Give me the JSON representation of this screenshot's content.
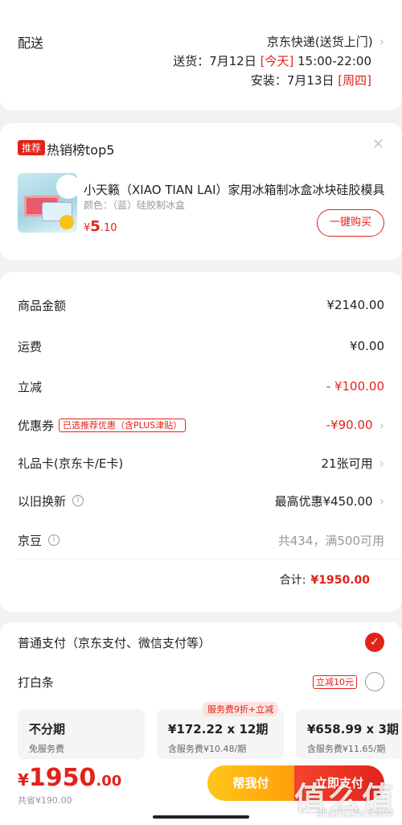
{
  "delivery": {
    "label": "配送",
    "method": "京东快递(送货上门)",
    "ship_label": "送货：7月12日",
    "ship_tag": "[今天]",
    "ship_time": "15:00-22:00",
    "install_label": "安装：7月13日",
    "install_tag": "[周四]"
  },
  "recommend": {
    "badge": "推荐",
    "title": "热销榜top5",
    "product_name": "小天籁（XIAO TIAN LAI）家用冰箱制冰盒冰块硅胶模具",
    "product_color": "颜色：（蓝）硅胶制冰盒",
    "price_symbol": "¥",
    "price_int": "5",
    "price_dec": ".10",
    "buy_label": "一键购买"
  },
  "summary": {
    "rows": [
      {
        "label": "商品金额",
        "value": "¥2140.00"
      },
      {
        "label": "运费",
        "value": "¥0.00"
      },
      {
        "label": "立减",
        "value": "- ¥100.00"
      },
      {
        "label": "优惠券",
        "tag": "已选推荐优惠（含PLUS津贴）",
        "value": "-¥90.00"
      },
      {
        "label": "礼品卡(京东卡/E卡)",
        "value": "21张可用"
      },
      {
        "label": "以旧换新",
        "value": "最高优惠¥450.00"
      },
      {
        "label": "京豆",
        "value": "共434，满500可用"
      }
    ],
    "total_label": "合计:",
    "total_value": "¥1950.00"
  },
  "payment": {
    "normal_label": "普通支付（京东支付、微信支付等）",
    "baitiao_label": "打白条",
    "baitiao_promo": "立减10元",
    "plan_badge": "服务费9折+立减",
    "plans": [
      {
        "title": "不分期",
        "sub": "免服务费"
      },
      {
        "title": "¥172.22 x 12期",
        "sub": "含服务费¥10.48/期"
      },
      {
        "title": "¥658.99 x 3期",
        "sub": "含服务费¥11.65/期"
      }
    ]
  },
  "bottom": {
    "price_symbol": "¥",
    "price_int": "1950",
    "price_dec": ".00",
    "saved": "共省¥190.00",
    "help_label": "帮我付",
    "pay_label": "立即支付"
  },
  "watermark": {
    "text": "值么值",
    "url": "zhizhizhi.com"
  },
  "colors": {
    "accent": "#e2231a",
    "help_button": "#ffb316",
    "background": "#f2f2f2"
  }
}
